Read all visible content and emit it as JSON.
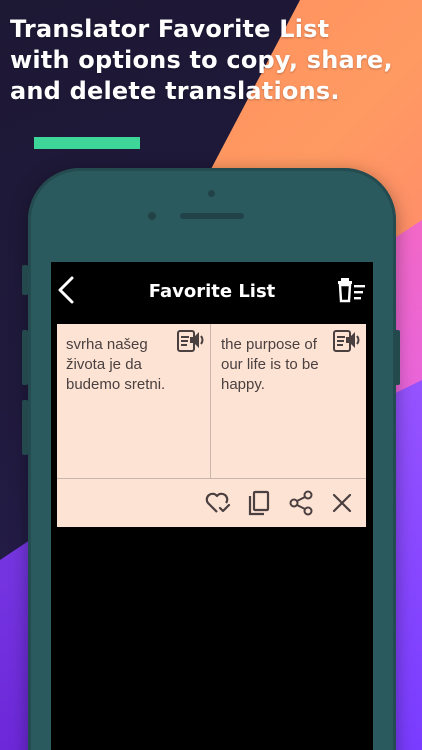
{
  "headline": {
    "line1": "Translator Favorite List",
    "line2": "with options to copy, share,",
    "line3": "and delete translations."
  },
  "app": {
    "title": "Favorite List"
  },
  "favorites": [
    {
      "source_text": "svrha našeg života je da budemo sretni.",
      "translated_text": "the purpose of our life is to be happy."
    }
  ],
  "icons": {
    "back": "chevron-left-icon",
    "delete_all": "delete-list-icon",
    "speak": "speaker-icon",
    "favorite": "heart-check-icon",
    "copy": "copy-icon",
    "share": "share-icon",
    "delete": "close-icon"
  },
  "colors": {
    "accent_bar": "#3dd598",
    "phone_body": "#2b5a5e",
    "card_background": "#fde3d4",
    "screen_background": "#000000"
  }
}
